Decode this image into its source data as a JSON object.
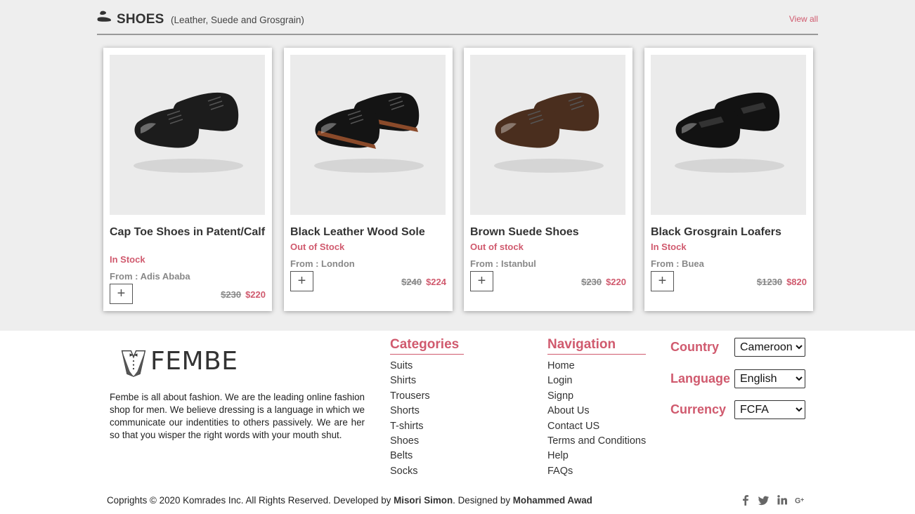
{
  "section": {
    "title": "SHOES",
    "subtitle": "(Leather, Suede and Grosgrain)",
    "view_all": "View all"
  },
  "products": [
    {
      "title": "Cap Toe Shoes in Patent/Calf",
      "stock": "In Stock",
      "from": "From : Adis Ababa",
      "old_price": "$230",
      "new_price": "$220",
      "add": "+",
      "color": "#1c1c1c"
    },
    {
      "title": "Black Leather Wood Sole",
      "stock": "Out of Stock",
      "from": "From : London",
      "old_price": "$240",
      "new_price": "$224",
      "add": "+",
      "color": "#141414"
    },
    {
      "title": "Brown Suede Shoes",
      "stock": "Out of stock",
      "from": "From : Istanbul",
      "old_price": "$230",
      "new_price": "$220",
      "add": "+",
      "color": "#4a2e1e"
    },
    {
      "title": "Black Grosgrain Loafers",
      "stock": "In Stock",
      "from": "From : Buea",
      "old_price": "$1230",
      "new_price": "$820",
      "add": "+",
      "color": "#121212"
    }
  ],
  "footer": {
    "logo_text": "FEMBE",
    "about": "Fembe is all about fashion. We are the leading online fashion shop for men. We believe dressing is a language in which we communicate our indentities to others passively. We are her so that you wisper the right words with your mouth shut.",
    "categories": {
      "title": "Categories",
      "items": [
        "Suits",
        "Shirts",
        "Trousers",
        "Shorts",
        "T-shirts",
        "Shoes",
        "Belts",
        "Socks"
      ]
    },
    "navigation": {
      "title": "Navigation",
      "items": [
        "Home",
        "Login",
        "Signp",
        "About Us",
        "Contact US",
        "Terms and Conditions",
        "Help",
        "FAQs"
      ]
    },
    "settings": {
      "country_label": "Country",
      "country_value": "Cameroon",
      "language_label": "Language",
      "language_value": "English",
      "currency_label": "Currency",
      "currency_value": "FCFA"
    },
    "copyright": {
      "text_1": "Coprights © 2020 Komrades Inc. All Rights Reserved. Developed by ",
      "developer": "Misori Simon",
      "text_2": ". Designed by ",
      "designer": "Mohammed Awad"
    },
    "socials": [
      "facebook-icon",
      "twitter-icon",
      "linkedin-icon",
      "google-plus-icon"
    ]
  },
  "colors": {
    "accent": "#d05a6e",
    "section_bg": "#eeeeee"
  }
}
